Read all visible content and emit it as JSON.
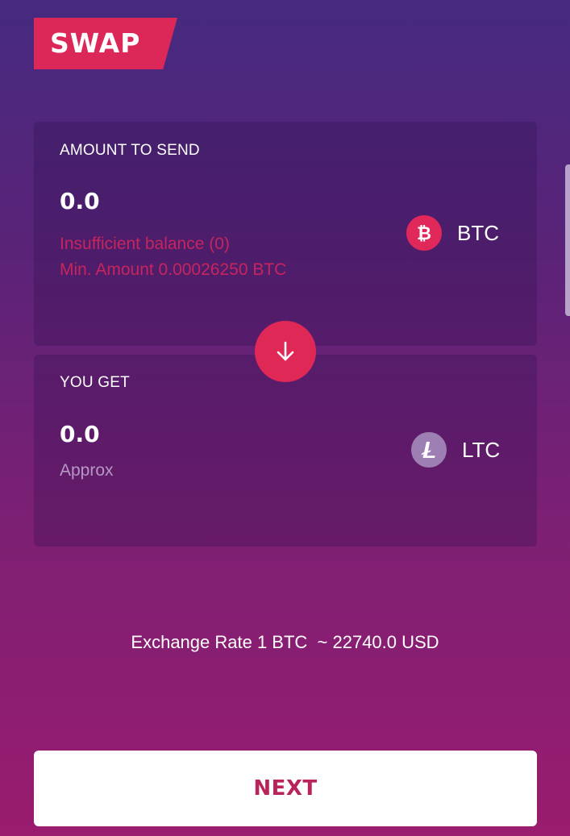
{
  "header": {
    "title": "SWAP"
  },
  "send_card": {
    "label": "AMOUNT TO SEND",
    "amount": "0.0",
    "error_balance": "Insufficient balance (0)",
    "error_min": "Min. Amount 0.00026250 BTC",
    "currency": "BTC",
    "currency_icon": "bitcoin-icon"
  },
  "swap_direction": {
    "icon": "arrow-down-icon"
  },
  "get_card": {
    "label": "YOU GET",
    "amount": "0.0",
    "note": "Approx",
    "currency": "LTC",
    "currency_icon": "litecoin-icon"
  },
  "exchange": {
    "text": "Exchange Rate 1 BTC  ~ 22740.0 USD"
  },
  "footer": {
    "next_label": "NEXT"
  },
  "colors": {
    "accent": "#e02857",
    "background_top": "#452a7f",
    "background_bottom": "#9a1c6e",
    "error": "#c8245e",
    "button_text": "#b8235c"
  }
}
